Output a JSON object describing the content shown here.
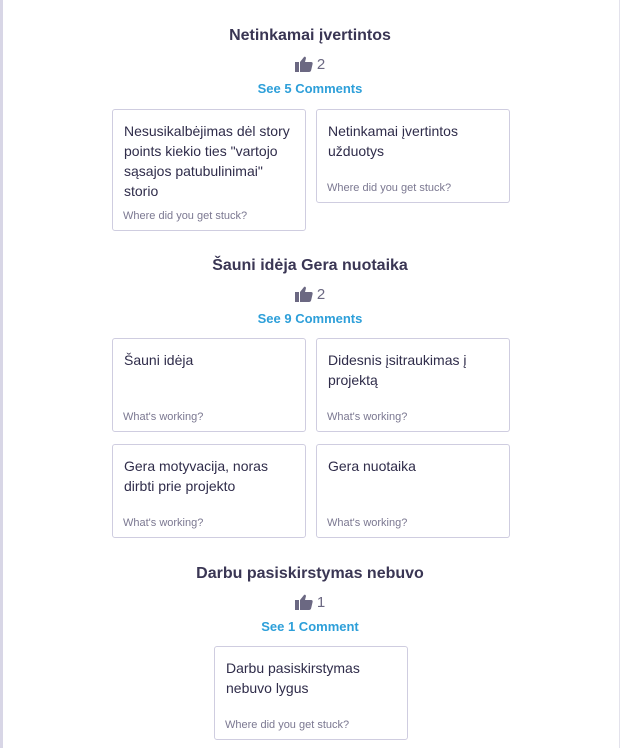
{
  "groups": [
    {
      "title": "Netinkamai įvertintos",
      "votes": "2",
      "comments_link": "See 5 Comments",
      "cards": [
        {
          "text": "Nesusikalbėjimas dėl story points kiekio ties \"vartojo sąsajos patubulinimai\" storio",
          "prompt": "Where did you get stuck?"
        },
        {
          "text": "Netinkamai įvertintos užduotys",
          "prompt": "Where did you get stuck?"
        }
      ]
    },
    {
      "title": "Šauni idėja Gera nuotaika",
      "votes": "2",
      "comments_link": "See 9 Comments",
      "cards": [
        {
          "text": "Šauni idėja",
          "prompt": "What's working?"
        },
        {
          "text": "Didesnis įsitraukimas į projektą",
          "prompt": "What's working?"
        },
        {
          "text": "Gera motyvacija, noras dirbti prie projekto",
          "prompt": "What's working?"
        },
        {
          "text": "Gera nuotaika",
          "prompt": "What's working?"
        }
      ]
    },
    {
      "title": "Darbu pasiskirstymas nebuvo",
      "votes": "1",
      "comments_link": "See 1 Comment",
      "cards": [
        {
          "text": "Darbu pasiskirstymas nebuvo lygus",
          "prompt": "Where did you get stuck?"
        }
      ]
    }
  ],
  "icons": {
    "vote": "thumbs-up-icon"
  },
  "colors": {
    "link": "#2d9fd9",
    "title": "#3a3654",
    "card_border": "#cfcde0"
  }
}
